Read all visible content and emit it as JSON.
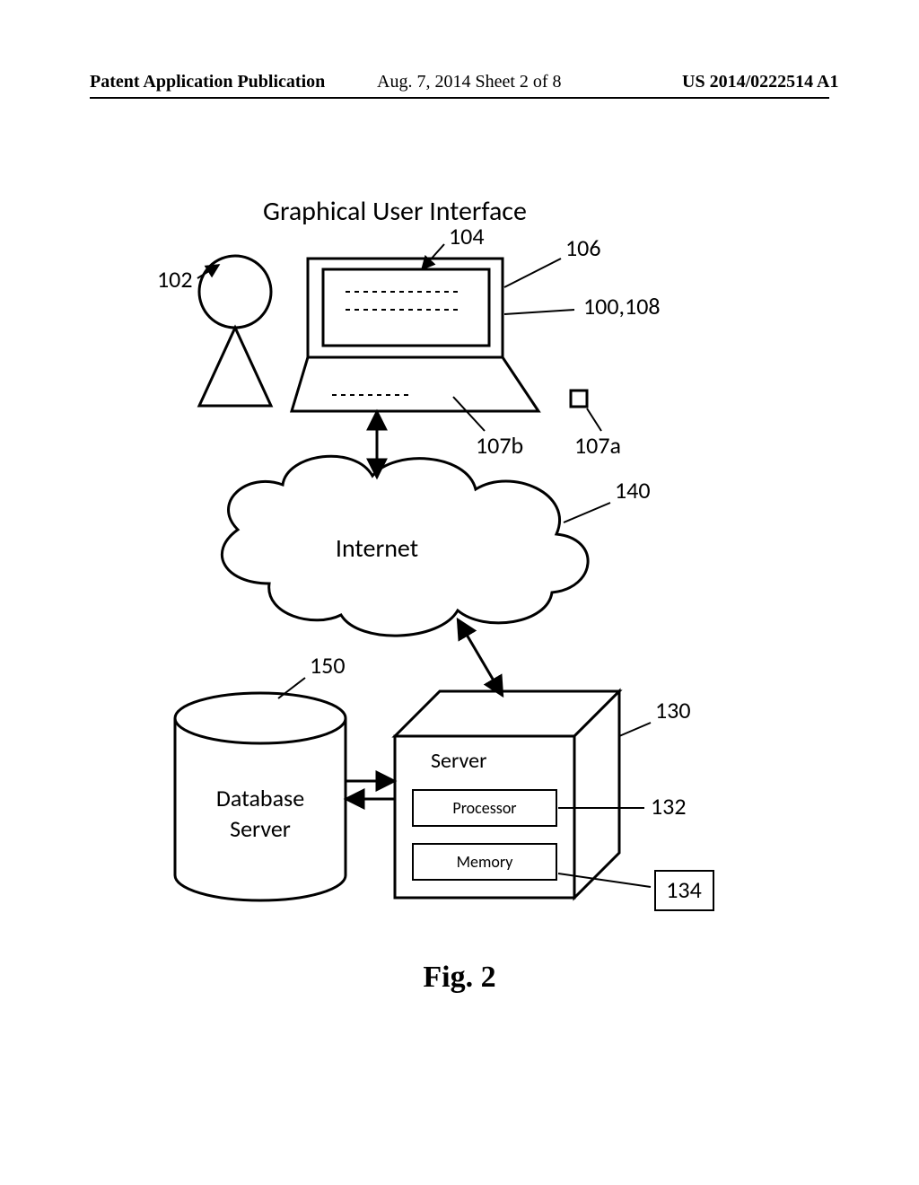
{
  "header": {
    "left": "Patent Application Publication",
    "center": "Aug. 7, 2014  Sheet 2 of 8",
    "right": "US 2014/0222514 A1"
  },
  "diagram": {
    "title": "Graphical User Interface",
    "labels": {
      "r102": "102",
      "r104": "104",
      "r106": "106",
      "r100_108": "100,108",
      "r107a": "107a",
      "r107b": "107b",
      "r140": "140",
      "r150": "150",
      "r130": "130",
      "r132": "132",
      "r134": "134"
    },
    "internet_label": "Internet",
    "db_line1": "Database",
    "db_line2": "Server",
    "server_label": "Server",
    "processor_label": "Processor",
    "memory_label": "Memory"
  },
  "figure_caption": "Fig. 2"
}
